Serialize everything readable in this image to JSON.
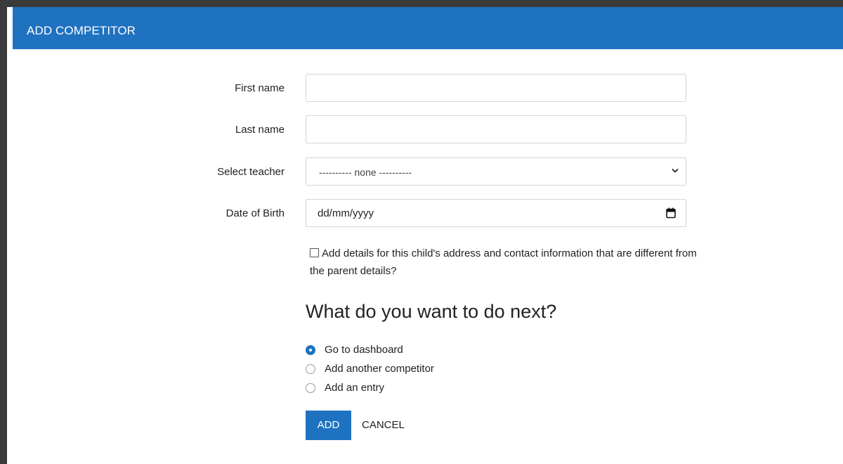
{
  "dialog": {
    "title": "ADD COMPETITOR"
  },
  "form": {
    "first_name": {
      "label": "First name",
      "value": ""
    },
    "last_name": {
      "label": "Last name",
      "value": ""
    },
    "teacher": {
      "label": "Select teacher",
      "selected": "---------- none ----------"
    },
    "dob": {
      "label": "Date of Birth",
      "value": "dd/mm/yyyy"
    },
    "contact_checkbox": {
      "label": "Add details for this child's address and contact information that are different from the parent details?",
      "checked": false
    }
  },
  "next": {
    "heading": "What do you want to do next?",
    "options": [
      {
        "label": "Go to dashboard",
        "checked": true
      },
      {
        "label": "Add another competitor",
        "checked": false
      },
      {
        "label": "Add an entry",
        "checked": false
      }
    ]
  },
  "actions": {
    "add_label": "ADD",
    "cancel_label": "CANCEL"
  },
  "colors": {
    "accent": "#1f72c0",
    "frame": "#3b3b3b"
  },
  "icons": {
    "select": "chevron-down-icon",
    "date": "calendar-icon"
  }
}
